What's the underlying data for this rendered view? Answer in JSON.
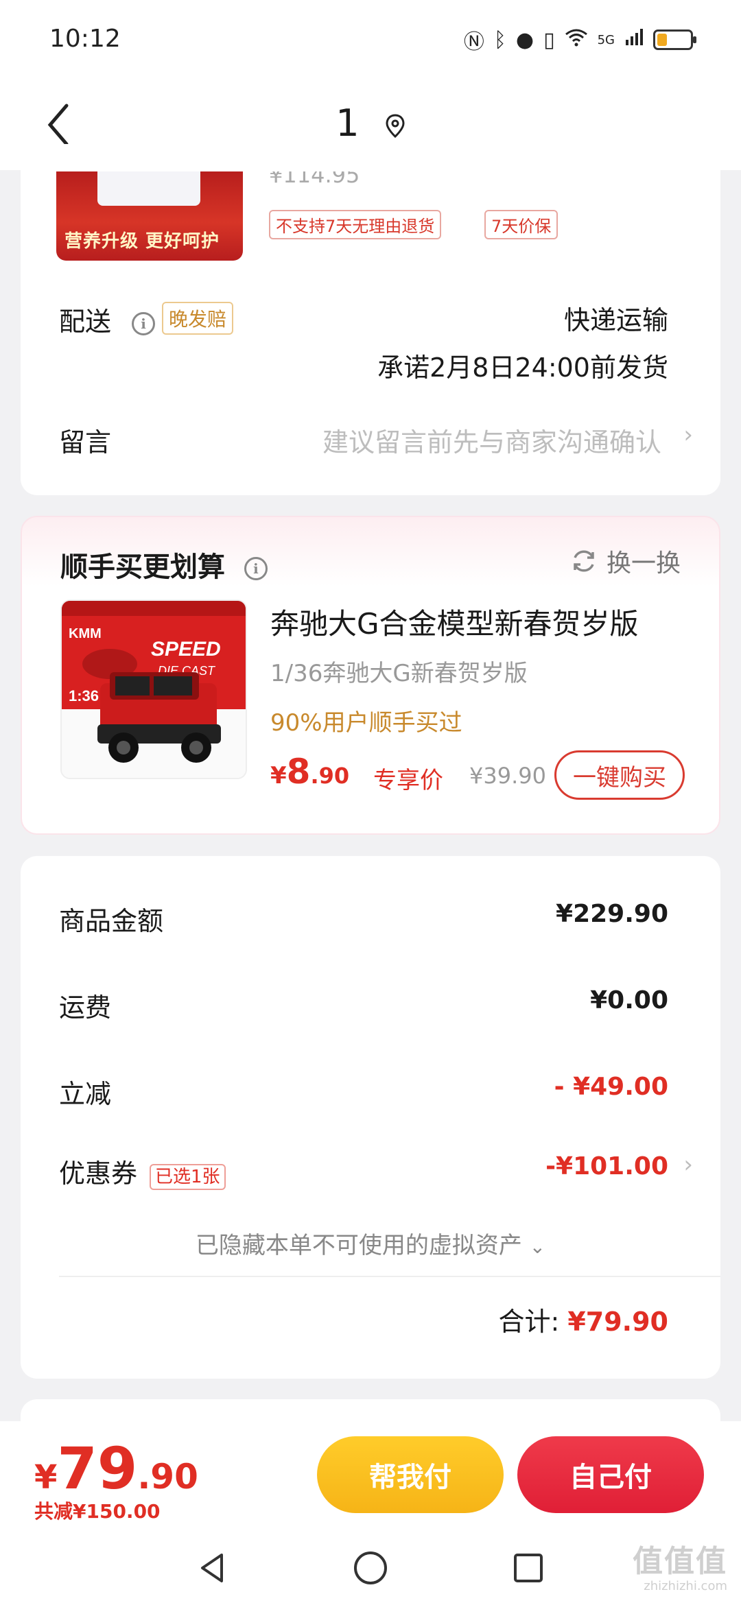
{
  "status_bar": {
    "time": "10:12",
    "network": "5G"
  },
  "header": {
    "title": "1"
  },
  "product": {
    "thumb_banner": "营养升级 更好呵护",
    "old_price": "¥114.95",
    "tags": [
      "不支持7天无理由退货",
      "7天价保"
    ]
  },
  "delivery": {
    "label": "配送",
    "late_tag": "晚发赔",
    "method": "快递运输",
    "promise": "承诺2月8日24:00前发货"
  },
  "note": {
    "label": "留言",
    "placeholder": "建议留言前先与商家沟通确认"
  },
  "recommend": {
    "title": "顺手买更划算",
    "swap_label": "换一换",
    "name": "奔驰大G合金模型新春贺岁版",
    "sub": "1/36奔驰大G新春贺岁版",
    "users": "90%用户顺手买过",
    "price_symbol": "¥",
    "price_int": "8",
    "price_dec": ".90",
    "exclusive": "专享价",
    "orig_price": "¥39.90",
    "buy_label": "一键购买",
    "img_text_speed": "SPEED",
    "img_text_diecast": "DIE CAST",
    "img_text_scale": "1:36",
    "img_text_brand": "KMM"
  },
  "summary": {
    "goods_label": "商品金额",
    "goods_value": "¥229.90",
    "shipping_label": "运费",
    "shipping_value": "¥0.00",
    "discount_label": "立减",
    "discount_value": "- ¥49.00",
    "coupon_label": "优惠券",
    "coupon_tag": "已选1张",
    "coupon_value": "-¥101.00",
    "hidden_assets": "已隐藏本单不可使用的虚拟资产",
    "total_label": "合计:",
    "total_value": "¥79.90"
  },
  "bottom": {
    "symbol": "¥",
    "int": "79",
    "dec": ".90",
    "saved": "共减¥150.00",
    "help_pay": "帮我付",
    "self_pay": "自己付"
  },
  "watermark": {
    "main": "值值值",
    "sub": "zhizhizhi.com"
  },
  "colors": {
    "accent_red": "#e02e24",
    "gold": "#c8892c",
    "yellow_btn": "#f6b417",
    "red_btn": "#e01f36"
  }
}
